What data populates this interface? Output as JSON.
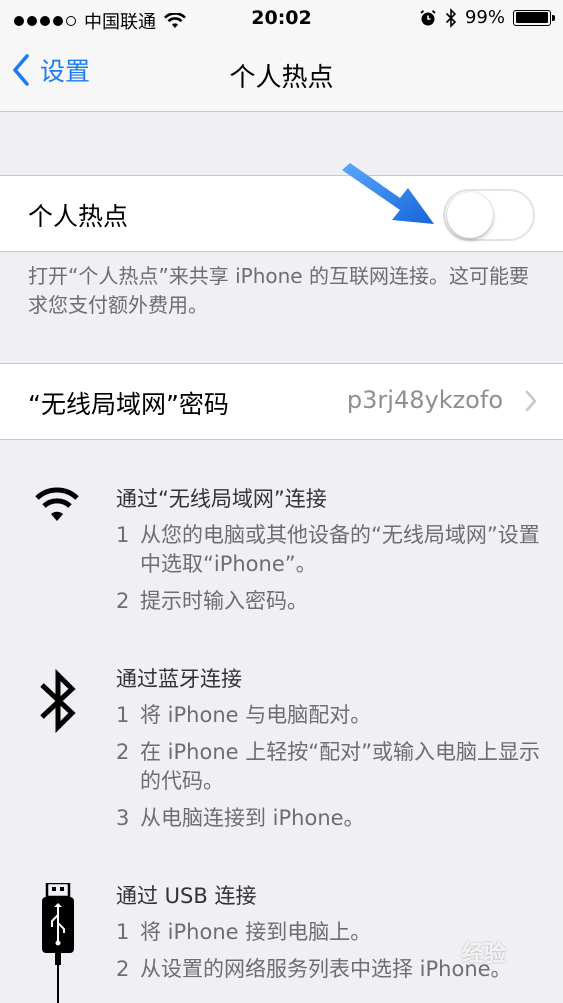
{
  "status_bar": {
    "carrier": "中国联通",
    "time": "20:02",
    "battery": "99%"
  },
  "nav": {
    "back_label": "设置",
    "title": "个人热点"
  },
  "hotspot": {
    "label": "个人热点",
    "enabled": false
  },
  "hotspot_note": "打开“个人热点”来共享 iPhone 的互联网连接。这可能要求您支付额外费用。",
  "wifi_password": {
    "label": "“无线局域网”密码",
    "value": "p3rj48ykzofo"
  },
  "methods": [
    {
      "icon": "wifi-icon",
      "title": "通过“无线局域网”连接",
      "steps": [
        {
          "num": "1",
          "text": "从您的电脑或其他设备的“无线局域网”设置中选取“iPhone”。"
        },
        {
          "num": "2",
          "text": "提示时输入密码。"
        }
      ]
    },
    {
      "icon": "bluetooth-icon",
      "title": "通过蓝牙连接",
      "steps": [
        {
          "num": "1",
          "text": "将 iPhone 与电脑配对。"
        },
        {
          "num": "2",
          "text": "在 iPhone 上轻按“配对”或输入电脑上显示的代码。"
        },
        {
          "num": "3",
          "text": "从电脑连接到 iPhone。"
        }
      ]
    },
    {
      "icon": "usb-cable-icon",
      "title": "通过 USB 连接",
      "steps": [
        {
          "num": "1",
          "text": "将 iPhone 接到电脑上。"
        },
        {
          "num": "2",
          "text": "从设置的网络服务列表中选择 iPhone。"
        }
      ]
    }
  ],
  "watermark": "经验",
  "colors": {
    "accent": "#1a7cf5",
    "background": "#efeff4",
    "secondary_text": "#6d6d72"
  }
}
